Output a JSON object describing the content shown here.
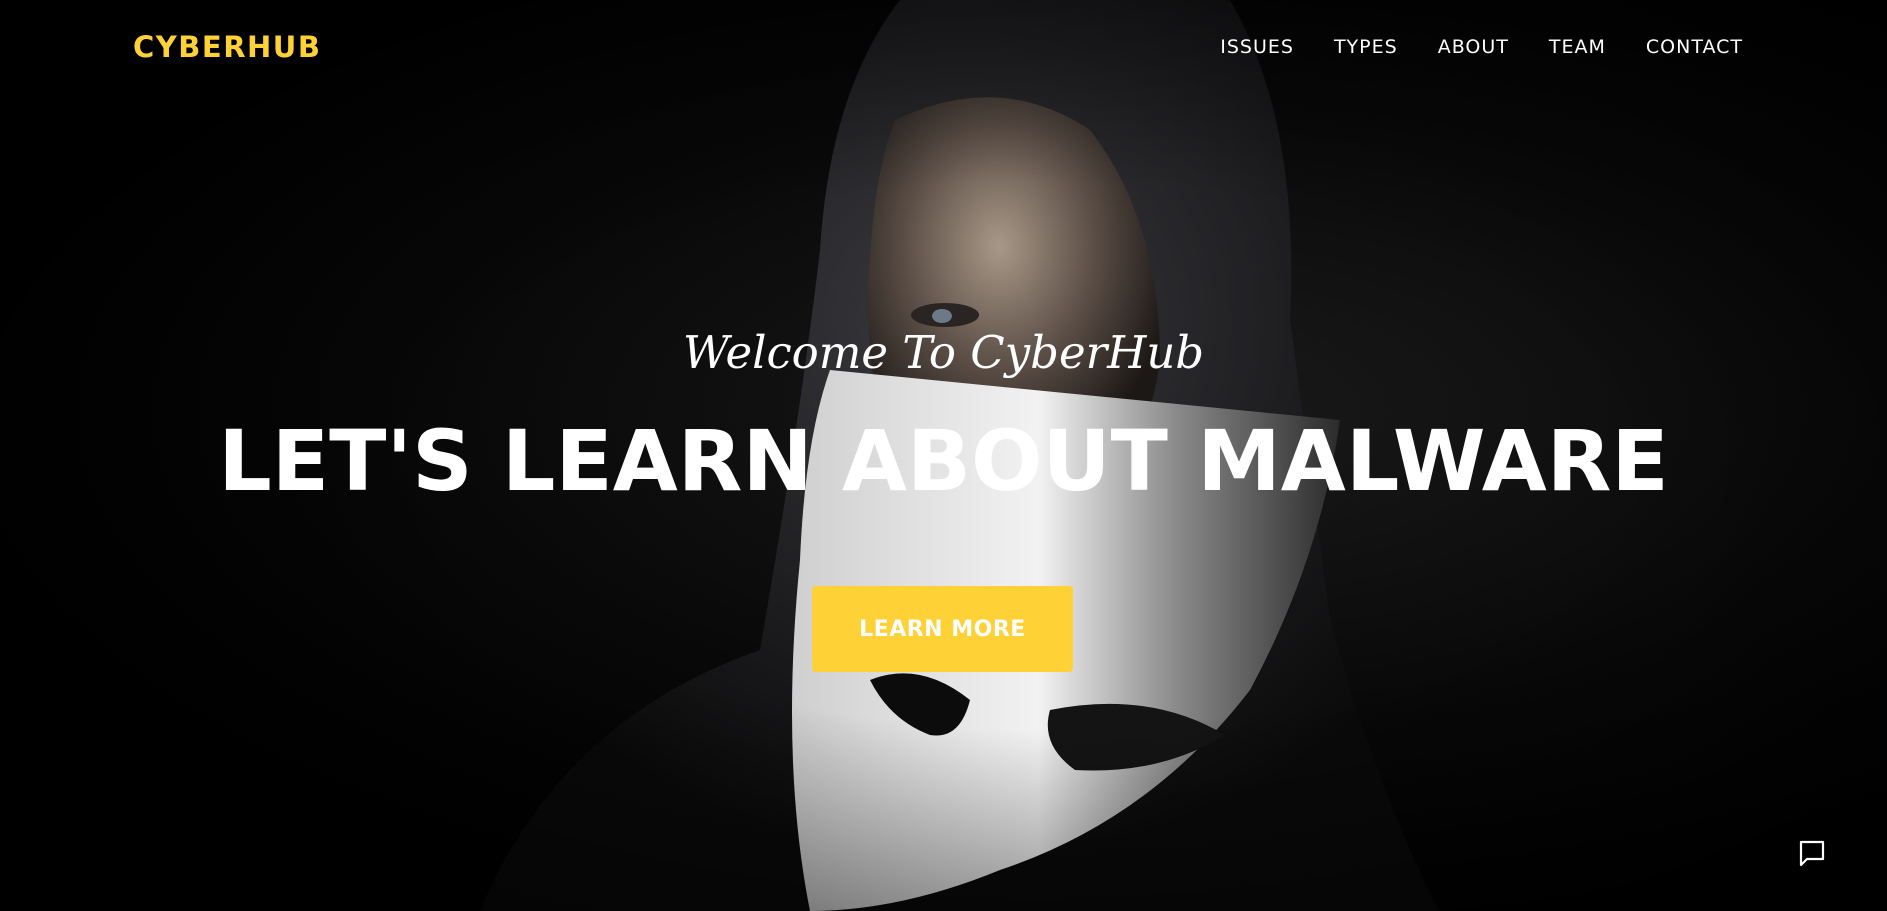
{
  "navbar": {
    "brand": "CYBERHUB",
    "links": [
      {
        "label": "ISSUES"
      },
      {
        "label": "TYPES"
      },
      {
        "label": "ABOUT"
      },
      {
        "label": "TEAM"
      },
      {
        "label": "CONTACT"
      }
    ]
  },
  "hero": {
    "subheading": "Welcome To CyberHub",
    "heading": "LET'S LEARN ABOUT MALWARE",
    "button_label": "LEARN MORE"
  },
  "icons": {
    "chat": "chat-icon"
  },
  "colors": {
    "accent": "#fed136",
    "text": "#ffffff",
    "background": "#000000"
  }
}
